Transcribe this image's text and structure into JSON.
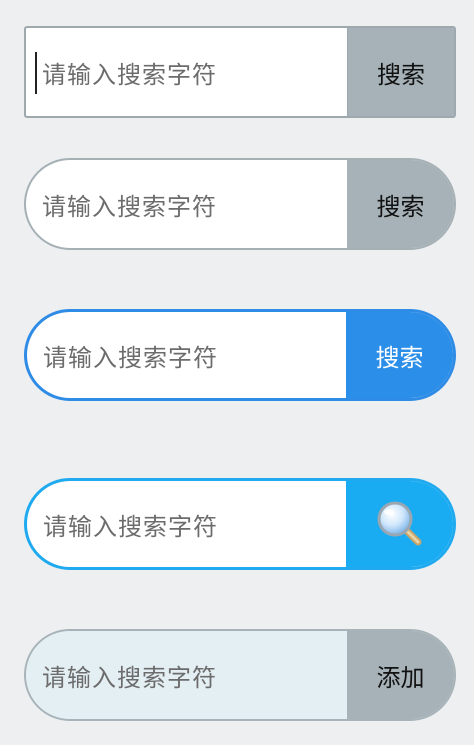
{
  "search_bars": [
    {
      "placeholder": "请输入搜索字符",
      "button_label": "搜索"
    },
    {
      "placeholder": "请输入搜索字符",
      "button_label": "搜索"
    },
    {
      "placeholder": "请输入搜索字符",
      "button_label": "搜索"
    },
    {
      "placeholder": "请输入搜索字符",
      "button_icon": "magnifier-icon"
    },
    {
      "placeholder": "请输入搜索字符",
      "button_label": "添加"
    }
  ],
  "colors": {
    "page_background": "#edeff1",
    "grey_button": "#a6b2b7",
    "blue_accent": "#2b8ee8",
    "light_blue_accent": "#1aacf2",
    "pale_field": "#e4eff4"
  }
}
